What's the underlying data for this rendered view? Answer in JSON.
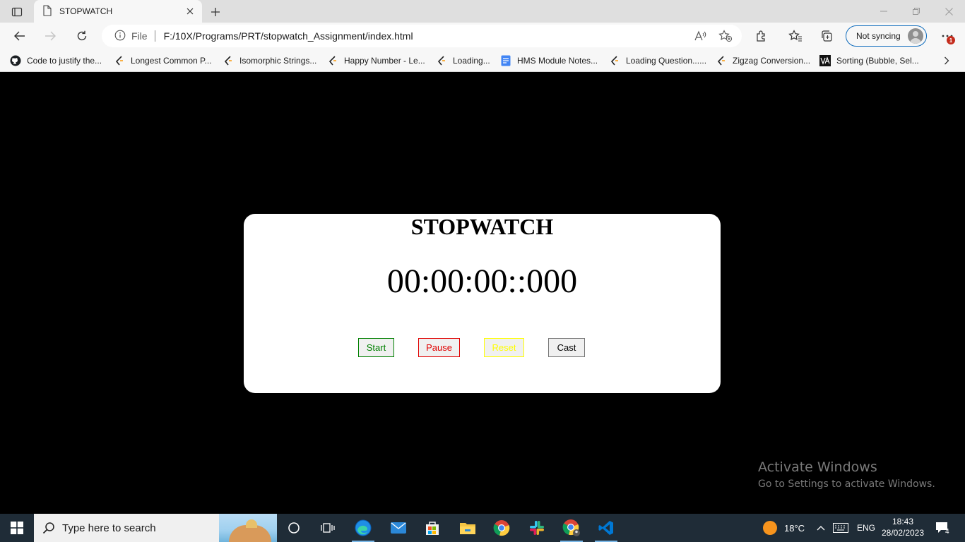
{
  "browser": {
    "tab": {
      "title": "STOPWATCH"
    },
    "address": {
      "scheme_label": "File",
      "url": "F:/10X/Programs/PRT/stopwatch_Assignment/index.html"
    },
    "profile": {
      "label": "Not syncing"
    },
    "notification_count": "1",
    "icons": [
      "tab-actions-icon",
      "page-icon",
      "close-icon",
      "plus-icon",
      "minimize-icon",
      "restore-icon",
      "close-window-icon",
      "back-icon",
      "forward-icon",
      "refresh-icon",
      "info-icon",
      "read-aloud-icon",
      "add-favorite-icon",
      "extensions-icon",
      "favorites-icon",
      "collections-icon",
      "more-icon"
    ]
  },
  "bookmarks": [
    {
      "label": "Code to justify the...",
      "icon": "github-icon"
    },
    {
      "label": "Longest Common P...",
      "icon": "geeks-icon"
    },
    {
      "label": "Isomorphic Strings...",
      "icon": "geeks-icon"
    },
    {
      "label": "Happy Number - Le...",
      "icon": "geeks-icon"
    },
    {
      "label": "Loading...",
      "icon": "geeks-icon"
    },
    {
      "label": "HMS Module Notes...",
      "icon": "docs-icon"
    },
    {
      "label": "Loading Question......",
      "icon": "geeks-icon"
    },
    {
      "label": "Zigzag Conversion...",
      "icon": "geeks-icon"
    },
    {
      "label": "Sorting (Bubble, Sel...",
      "icon": "va-icon"
    }
  ],
  "stopwatch": {
    "title": "STOPWATCH",
    "time": "00:00:00::000",
    "buttons": {
      "start": "Start",
      "pause": "Pause",
      "reset": "Reset",
      "cast": "Cast"
    },
    "colors": {
      "start": "#008000",
      "pause": "#e00000",
      "reset": "#ffff00",
      "cast": "#000000"
    }
  },
  "watermark": {
    "title": "Activate Windows",
    "subtitle": "Go to Settings to activate Windows."
  },
  "taskbar": {
    "search_placeholder": "Type here to search",
    "weather": "18°C",
    "language": "ENG",
    "time": "18:43",
    "date": "28/02/2023",
    "notification_count": "4",
    "apps": [
      "cortana-icon",
      "task-view-icon",
      "edge-icon",
      "mail-icon",
      "store-icon",
      "file-explorer-icon",
      "chrome-icon",
      "slack-icon",
      "chrome-profile-icon",
      "vscode-icon"
    ]
  }
}
